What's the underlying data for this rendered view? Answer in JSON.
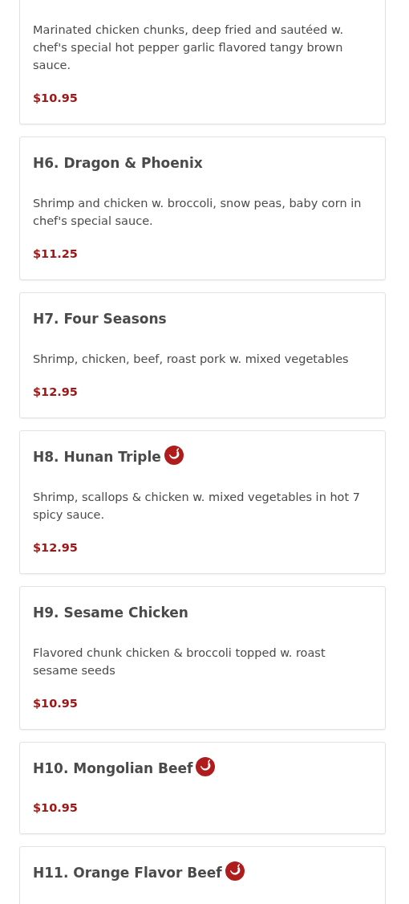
{
  "items": [
    {
      "description": "Marinated chicken chunks, deep fried and sautéed w. chef's special hot pepper garlic flavored tangy brown sauce.",
      "price": "$10.95",
      "spicy": false
    },
    {
      "title": "H6. Dragon & Phoenix",
      "description": "Shrimp and chicken w. broccoli, snow peas, baby corn in chef's special sauce.",
      "price": "$11.25",
      "spicy": false
    },
    {
      "title": "H7. Four Seasons",
      "description": "Shrimp, chicken, beef, roast pork w. mixed vegetables",
      "price": "$12.95",
      "spicy": false
    },
    {
      "title": "H8. Hunan Triple",
      "description": "Shrimp, scallops & chicken w. mixed vegetables in hot 7 spicy sauce.",
      "price": "$12.95",
      "spicy": true
    },
    {
      "title": "H9. Sesame Chicken",
      "description": "Flavored chunk chicken & broccoli topped w. roast sesame seeds",
      "price": "$10.95",
      "spicy": false
    },
    {
      "title": "H10. Mongolian Beef",
      "price": "$10.95",
      "spicy": true
    },
    {
      "title": "H11. Orange Flavor Beef",
      "spicy": true
    }
  ]
}
